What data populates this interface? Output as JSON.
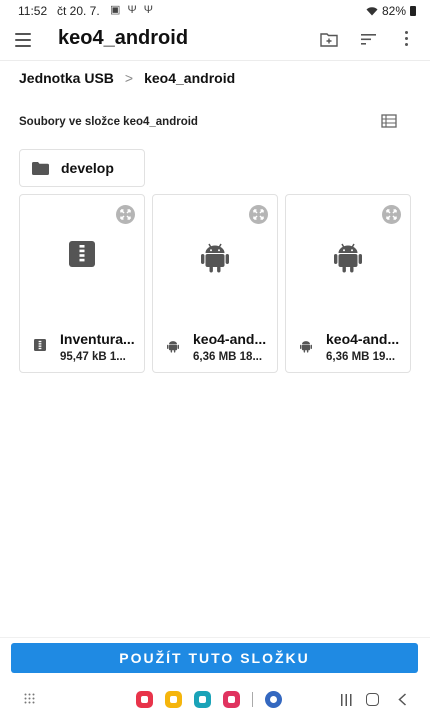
{
  "status_bar": {
    "time": "11:52",
    "date": "čt 20. 7.",
    "left_icons": "▣ Ψ Ψ",
    "battery": "82%"
  },
  "app_bar": {
    "title": "keo4_android"
  },
  "breadcrumb": {
    "root": "Jednotka USB",
    "separator": ">",
    "current": "keo4_android"
  },
  "section": {
    "label": "Soubory ve složce keo4_android"
  },
  "folders": [
    {
      "name": "develop"
    }
  ],
  "files": [
    {
      "name": "Inventura...",
      "meta": "95,47 kB 1...",
      "icon": "archive-icon"
    },
    {
      "name": "keo4-and...",
      "meta": "6,36 MB 18...",
      "icon": "android-icon"
    },
    {
      "name": "keo4-and...",
      "meta": "6,36 MB 19...",
      "icon": "android-icon"
    }
  ],
  "action": {
    "use_folder_label": "POUŽÍT TUTO SLOŽKU"
  },
  "colors": {
    "accent": "#1f8ae3",
    "icon_gray": "#555555"
  },
  "dock": [
    {
      "icon": "red-app-icon",
      "color": "#e8344a"
    },
    {
      "icon": "yellow-app-icon",
      "color": "#f5b50c"
    },
    {
      "icon": "calendar-app-icon",
      "color": "#1aa3b8"
    },
    {
      "icon": "pink-app-icon",
      "color": "#e0335f"
    },
    {
      "icon": "settings-app-icon",
      "color": "#3468c0"
    }
  ]
}
